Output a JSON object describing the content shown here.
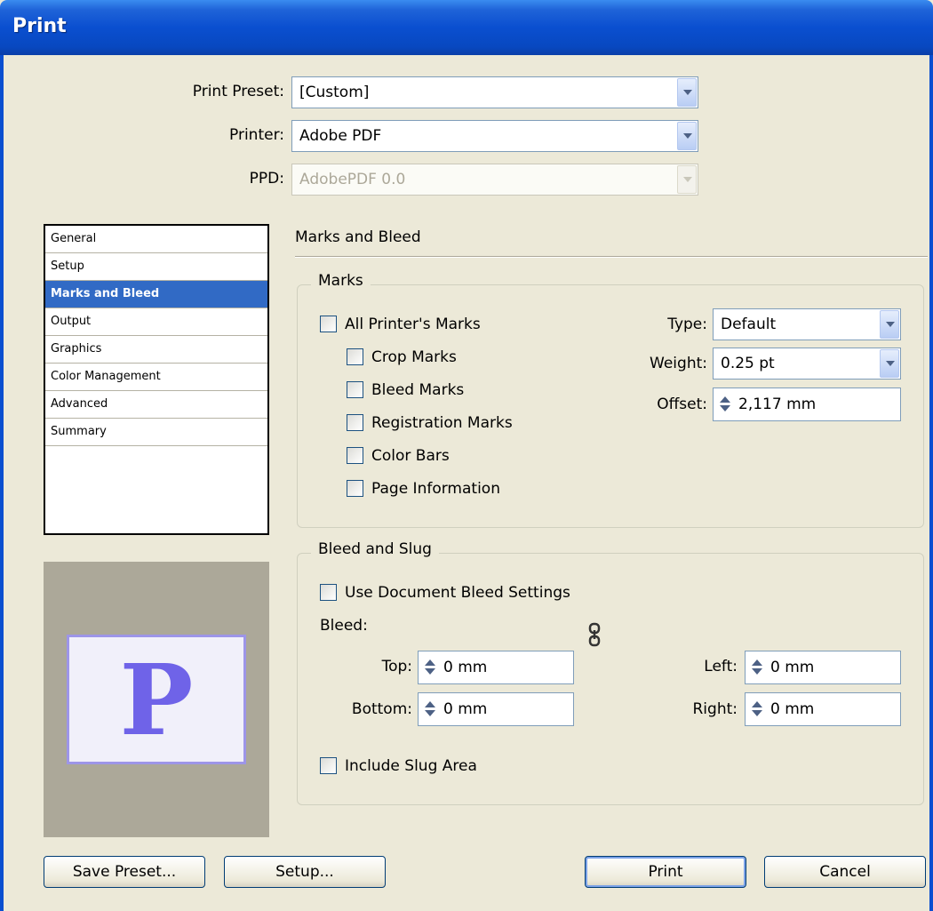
{
  "window": {
    "title": "Print"
  },
  "preset": {
    "print_preset_label": "Print Preset:",
    "print_preset_value": "[Custom]",
    "printer_label": "Printer:",
    "printer_value": "Adobe PDF",
    "ppd_label": "PPD:",
    "ppd_value": "AdobePDF 0.0"
  },
  "sidebar": {
    "items": [
      {
        "label": "General"
      },
      {
        "label": "Setup"
      },
      {
        "label": "Marks and Bleed"
      },
      {
        "label": "Output"
      },
      {
        "label": "Graphics"
      },
      {
        "label": "Color Management"
      },
      {
        "label": "Advanced"
      },
      {
        "label": "Summary"
      }
    ],
    "selected": "Marks and Bleed"
  },
  "section": {
    "title": "Marks and Bleed"
  },
  "marks": {
    "group_title": "Marks",
    "all_printers_marks": "All Printer's Marks",
    "crop_marks": "Crop Marks",
    "bleed_marks": "Bleed Marks",
    "registration_marks": "Registration Marks",
    "color_bars": "Color Bars",
    "page_information": "Page Information",
    "type_label": "Type:",
    "type_value": "Default",
    "weight_label": "Weight:",
    "weight_value": "0.25 pt",
    "offset_label": "Offset:",
    "offset_value": "2,117 mm"
  },
  "bleed": {
    "group_title": "Bleed and Slug",
    "use_document_bleed": "Use Document Bleed Settings",
    "bleed_label": "Bleed:",
    "top_label": "Top:",
    "top_value": "0 mm",
    "bottom_label": "Bottom:",
    "bottom_value": "0 mm",
    "left_label": "Left:",
    "left_value": "0 mm",
    "right_label": "Right:",
    "right_value": "0 mm",
    "include_slug": "Include Slug Area"
  },
  "preview": {
    "glyph": "P"
  },
  "buttons": {
    "save_preset": "Save Preset...",
    "setup": "Setup...",
    "print": "Print",
    "cancel": "Cancel"
  },
  "colors": {
    "titlebar": "#0a4fd0",
    "selection": "#316ac5",
    "preview_glyph": "#6f63e8"
  }
}
